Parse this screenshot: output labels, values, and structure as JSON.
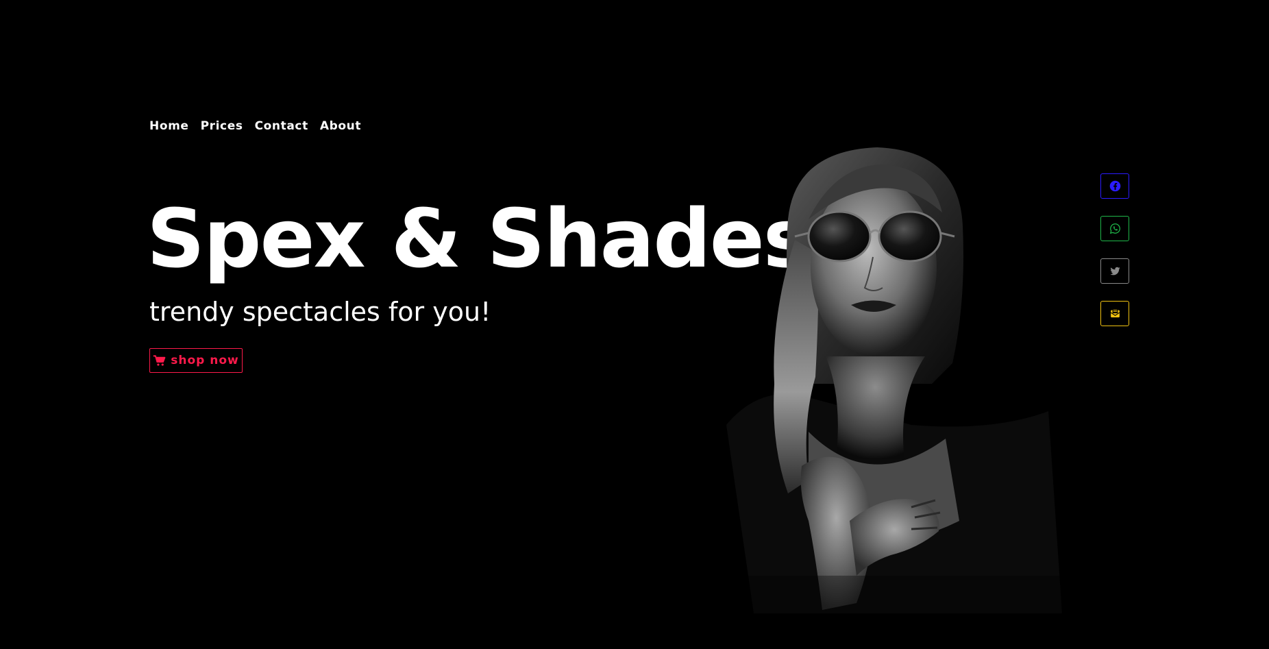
{
  "nav": {
    "items": [
      {
        "label": "Home"
      },
      {
        "label": "Prices"
      },
      {
        "label": "Contact"
      },
      {
        "label": "About"
      }
    ]
  },
  "hero": {
    "title": "Spex & Shades",
    "subtitle": "trendy spectacles for you!",
    "cta": {
      "label": "shop now",
      "icon": "cart-icon"
    }
  },
  "social": [
    {
      "name": "facebook",
      "icon": "facebook-icon",
      "color": "#2b1cff"
    },
    {
      "name": "whatsapp",
      "icon": "whatsapp-icon",
      "color": "#1fb84a"
    },
    {
      "name": "twitter",
      "icon": "twitter-icon",
      "color": "#8a8a8a"
    },
    {
      "name": "email",
      "icon": "mail-icon",
      "color": "#f2c311"
    }
  ],
  "colors": {
    "background": "#000000",
    "text": "#ffffff",
    "accent": "#ff1a4b"
  }
}
